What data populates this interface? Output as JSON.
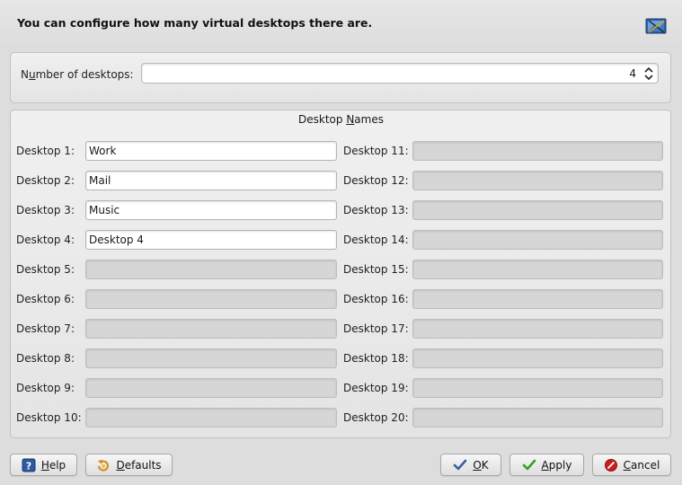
{
  "header": {
    "text": "You can configure how many virtual desktops there are."
  },
  "number_of_desktops": {
    "label_prefix": "N",
    "label_mnemonic": "u",
    "label_rest": "mber of desktops:",
    "value": "4"
  },
  "desktop_names": {
    "title_prefix": "Desktop ",
    "title_mnemonic": "N",
    "title_rest": "ames",
    "left": [
      {
        "label": "Desktop 1:",
        "value": "Work",
        "enabled": true
      },
      {
        "label": "Desktop 2:",
        "value": "Mail",
        "enabled": true
      },
      {
        "label": "Desktop 3:",
        "value": "Music",
        "enabled": true
      },
      {
        "label": "Desktop 4:",
        "value": "Desktop 4",
        "enabled": true
      },
      {
        "label": "Desktop 5:",
        "value": "",
        "enabled": false
      },
      {
        "label": "Desktop 6:",
        "value": "",
        "enabled": false
      },
      {
        "label": "Desktop 7:",
        "value": "",
        "enabled": false
      },
      {
        "label": "Desktop 8:",
        "value": "",
        "enabled": false
      },
      {
        "label": "Desktop 9:",
        "value": "",
        "enabled": false
      },
      {
        "label": "Desktop 10:",
        "value": "",
        "enabled": false
      }
    ],
    "right": [
      {
        "label": "Desktop 11:",
        "value": "",
        "enabled": false
      },
      {
        "label": "Desktop 12:",
        "value": "",
        "enabled": false
      },
      {
        "label": "Desktop 13:",
        "value": "",
        "enabled": false
      },
      {
        "label": "Desktop 14:",
        "value": "",
        "enabled": false
      },
      {
        "label": "Desktop 15:",
        "value": "",
        "enabled": false
      },
      {
        "label": "Desktop 16:",
        "value": "",
        "enabled": false
      },
      {
        "label": "Desktop 17:",
        "value": "",
        "enabled": false
      },
      {
        "label": "Desktop 18:",
        "value": "",
        "enabled": false
      },
      {
        "label": "Desktop 19:",
        "value": "",
        "enabled": false
      },
      {
        "label": "Desktop 20:",
        "value": "",
        "enabled": false
      }
    ]
  },
  "buttons": {
    "help": {
      "mnemonic": "H",
      "rest": "elp",
      "icon": "help-icon"
    },
    "defaults": {
      "mnemonic": "D",
      "rest": "efaults",
      "icon": "defaults-icon"
    },
    "ok": {
      "mnemonic": "O",
      "rest": "K",
      "icon": "checkmark-icon"
    },
    "apply": {
      "mnemonic": "A",
      "rest": "pply",
      "icon": "checkmark-icon"
    },
    "cancel": {
      "mnemonic": "C",
      "rest": "ancel",
      "icon": "cancel-icon"
    }
  },
  "colors": {
    "ok_check": "#3a5fa0",
    "apply_check": "#3d9a2e",
    "cancel_red": "#c8201e"
  }
}
